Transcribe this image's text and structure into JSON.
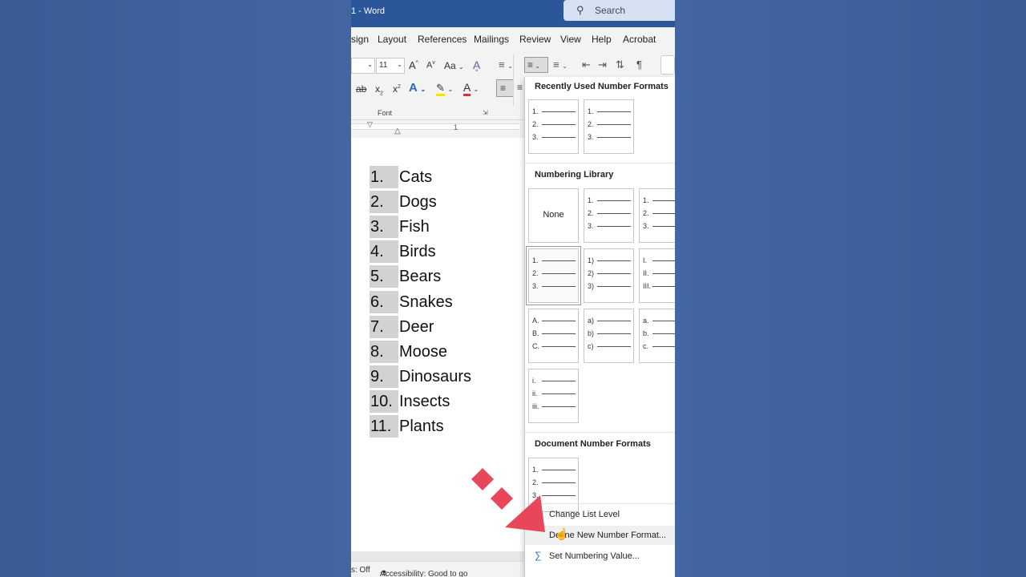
{
  "titlebar": {
    "title": "1 - Word",
    "search_icon": "search-icon",
    "search_label": "Search"
  },
  "menubar": {
    "tabs": [
      "sign",
      "Layout",
      "References",
      "Mailings",
      "Review",
      "View",
      "Help",
      "Acrobat"
    ]
  },
  "ribbon": {
    "font_size": "11",
    "group_label": "Font",
    "pilcrow": "¶",
    "grow_font": "A",
    "shrink_font": "A",
    "change_case": "Aa",
    "subscript": "x",
    "superscript": "x",
    "ruler_number": "1"
  },
  "document": {
    "list": [
      {
        "num": "1.",
        "text": "Cats"
      },
      {
        "num": "2.",
        "text": "Dogs"
      },
      {
        "num": "3.",
        "text": "Fish"
      },
      {
        "num": "4.",
        "text": "Birds"
      },
      {
        "num": "5.",
        "text": "Bears"
      },
      {
        "num": "6.",
        "text": "Snakes"
      },
      {
        "num": "7.",
        "text": "Deer"
      },
      {
        "num": "8.",
        "text": "Moose"
      },
      {
        "num": "9.",
        "text": "Dinosaurs"
      },
      {
        "num": "10.",
        "text": "Insects"
      },
      {
        "num": "11.",
        "text": "Plants"
      }
    ]
  },
  "dropdown": {
    "recent_header": "Recently Used Number Formats",
    "library_header": "Numbering Library",
    "document_header": "Document Number Formats",
    "none_label": "None",
    "recent": [
      [
        "1.",
        "2.",
        "3."
      ],
      [
        "1.",
        "2.",
        "3."
      ]
    ],
    "library": [
      [
        "1.",
        "2.",
        "3."
      ],
      [
        "1.",
        "2.",
        "3."
      ],
      [
        "1.",
        "2.",
        "3."
      ],
      [
        "1)",
        "2)",
        "3)"
      ],
      [
        "I.",
        "II.",
        "III."
      ],
      [
        "A.",
        "B.",
        "C."
      ],
      [
        "a)",
        "b)",
        "c)"
      ],
      [
        "a.",
        "b.",
        "c."
      ],
      [
        "i.",
        "ii.",
        "iii."
      ]
    ],
    "document_formats": [
      [
        "1.",
        "2.",
        "3."
      ]
    ],
    "menu": {
      "change_level": "Change List Level",
      "define_new": "Define New Number Format...",
      "set_value": "Set Numbering Value..."
    }
  },
  "statusbar": {
    "track": "s: Off",
    "accessibility": "Accessibility: Good to go"
  },
  "colors": {
    "titlebar": "#2b579a",
    "overlay_arrow": "#e8475a",
    "highlight_color": "#f5e400",
    "font_color": "#d13438"
  }
}
